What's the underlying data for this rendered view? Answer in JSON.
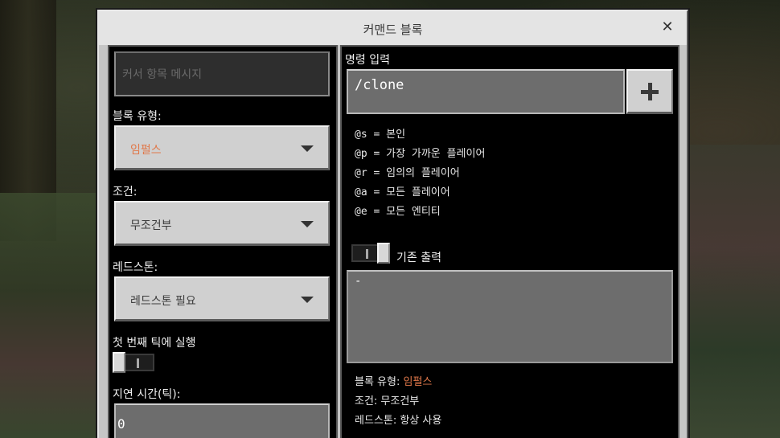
{
  "window": {
    "title": "커맨드 블록",
    "close_glyph": "✕"
  },
  "left": {
    "hover_note_placeholder": "커서 항목 메시지",
    "block_type": {
      "label": "블록 유형:",
      "value": "임펄스"
    },
    "condition": {
      "label": "조건:",
      "value": "무조건부"
    },
    "redstone": {
      "label": "레드스톤:",
      "value": "레드스톤 필요"
    },
    "execute_first_tick": {
      "label": "첫 번째 틱에 실행",
      "on": false
    },
    "delay": {
      "label": "지연 시간(틱):",
      "value": "0"
    }
  },
  "right": {
    "command_label": "명령 입력",
    "command_value": "/clone",
    "add_button_icon": "plus-icon",
    "hints": [
      "@s = 본인",
      "@p = 가장 가까운 플레이어",
      "@r = 임의의 플레이어",
      "@a = 모든 플레이어",
      "@e = 모든 엔티티"
    ],
    "previous_output": {
      "label": "기존 출력",
      "on": true,
      "value": "-"
    },
    "summary": {
      "block_type_label": "블록 유형:",
      "block_type_value": "임펄스",
      "condition": "조건: 무조건부",
      "redstone": "레드스톤: 항상 사용"
    }
  },
  "colors": {
    "impulse_accent": "#e0784a",
    "panel_bg": "#000000",
    "dialog_frame": "#c6c6c6"
  }
}
